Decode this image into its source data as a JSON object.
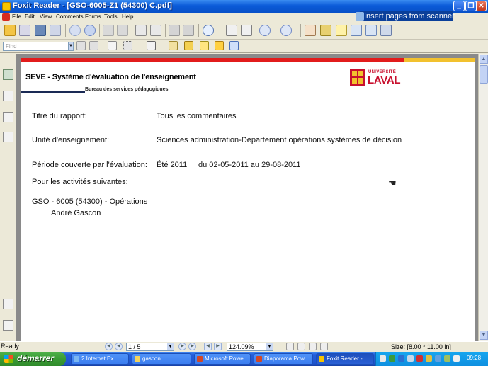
{
  "window": {
    "title": "Foxit Reader - [GSO-6005-Z1 (54300) C.pdf]"
  },
  "menu": [
    "File",
    "Edit",
    "View",
    "Comments",
    "Forms",
    "Tools",
    "Help"
  ],
  "banner": {
    "label": "Insert pages from scanner"
  },
  "find": {
    "placeholder": "Find"
  },
  "document": {
    "header_title": "SEVE - Système d'évaluation de l'enseignement",
    "header_subtitle": "Bureau des services pédagogiques",
    "logo_small": "UNIVERSITÉ",
    "logo_big": "LAVAL",
    "fields": {
      "report_label": "Titre du rapport:",
      "report_value": "Tous les commentaires",
      "unit_label": "Unité d'enseignement:",
      "unit_value": "Sciences administration-Département opérations systèmes de décision",
      "period_label": "Période couverte par l'évaluation:",
      "period_term": "Été 2011",
      "period_dates": "du 02-05-2011 au 29-08-2011",
      "activities_label": "Pour les activités suivantes:",
      "course": "GSO - 6005 (54300) - Opérations",
      "instructor": "André Gascon"
    }
  },
  "status": {
    "text": "Ready",
    "page": "1 / 5",
    "zoom": "124.09%",
    "size": "Size: [8.00 * 11.00 in]"
  },
  "taskbar": {
    "start": "démarrer",
    "tasks": [
      "2 Internet Ex...",
      "gascon",
      "Microsoft Powe...",
      "Diaporama Pow...",
      "Foxit Reader - ..."
    ],
    "clock": "09:28"
  },
  "colors": {
    "accent_red": "#e21c1c",
    "accent_gold": "#f2c12e",
    "laval_red": "#c8102e"
  }
}
